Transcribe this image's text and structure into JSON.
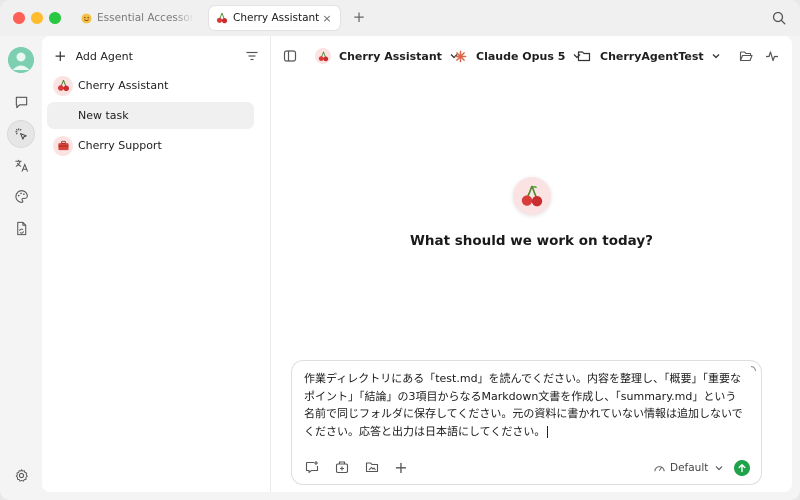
{
  "titlebar": {
    "tabs": [
      {
        "label": "Essential Accessories",
        "icon": "smiley-emoji-icon",
        "active": false
      },
      {
        "label": "Cherry Assistant",
        "icon": "cherry-icon",
        "active": true,
        "close": "×"
      }
    ],
    "new_tab": "+"
  },
  "sidebar": {
    "add_agent_label": "Add Agent",
    "agents": [
      {
        "label": "Cherry Assistant",
        "icon": "cherry-icon"
      },
      {
        "label": "New task",
        "icon": "",
        "selected": true
      },
      {
        "label": "Cherry Support",
        "icon": "toolbox-icon"
      }
    ]
  },
  "toolbar": {
    "assistant": "Cherry Assistant",
    "model": "Claude Opus 5",
    "folder": "CherryAgentTest"
  },
  "main": {
    "heading": "What should we work on today?"
  },
  "composer": {
    "text": "作業ディレクトリにある「test.md」を読んでください。内容を整理し、「概要」「重要なポイント」「結論」の3項目からなるMarkdown文書を作成し、「summary.md」という名前で同じフォルダに保存してください。元の資料に書かれていない情報は追加しないでください。応答と出力は日本語にしてください。",
    "mode": "Default"
  },
  "colors": {
    "accent_green": "#1fa34a",
    "cherry_red": "#d93a3a",
    "avatar_teal": "#5fbfa0"
  }
}
